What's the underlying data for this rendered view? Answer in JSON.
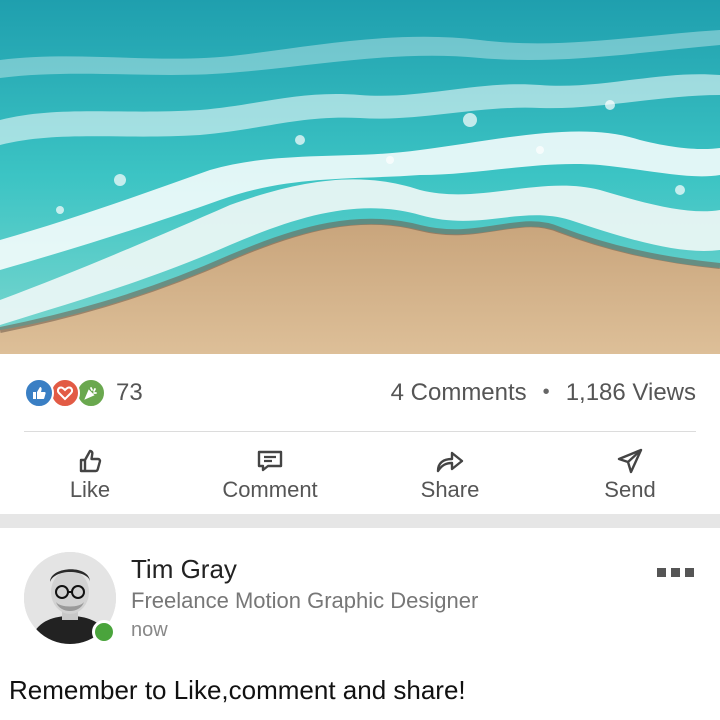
{
  "post_image": {
    "description_icon": "image-icon"
  },
  "reactions": {
    "icons": [
      "like-reaction-icon",
      "love-reaction-icon",
      "celebrate-reaction-icon"
    ],
    "count": "73",
    "comments": "4 Comments",
    "separator": "•",
    "views": "1,186 Views"
  },
  "actions": {
    "like": "Like",
    "comment": "Comment",
    "share": "Share",
    "send": "Send"
  },
  "author": {
    "name": "Tim Gray",
    "headline": "Freelance Motion Graphic Designer",
    "timestamp": "now"
  },
  "post": {
    "text": "Remember to Like,comment and share!"
  },
  "colors": {
    "like_blue": "#3a7fc4",
    "love_red": "#e25b45",
    "celebrate_green": "#6aa84f",
    "online_green": "#4aa43c",
    "sand": "#d9b88f",
    "sea": "#2bb5b8"
  }
}
